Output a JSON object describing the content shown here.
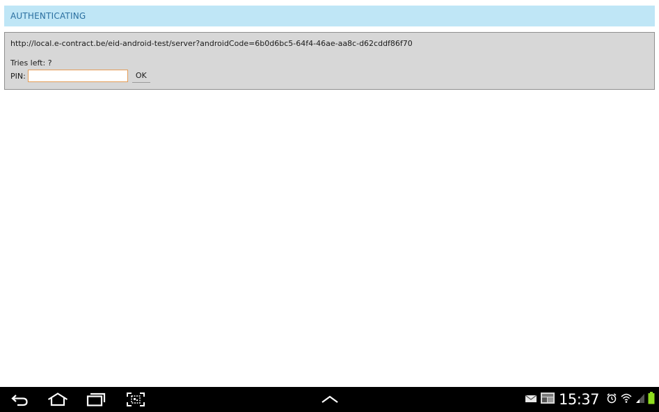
{
  "header": {
    "title": "AUTHENTICATING"
  },
  "panel": {
    "url": "http://local.e-contract.be/eid-android-test/server?androidCode=6b0d6bc5-64f4-46ae-aa8c-d62cddf86f70",
    "tries_left": "Tries left: ?",
    "pin_label": "PIN:",
    "pin_value": "",
    "ok_label": "OK"
  },
  "system_bar": {
    "time": "15:37",
    "icons": {
      "back": "back-icon",
      "home": "home-icon",
      "recents": "recent-apps-icon",
      "screenshot": "screenshot-icon",
      "up": "chevron-up-icon",
      "email": "email-icon",
      "gallery": "gallery-icon",
      "alarm": "alarm-icon",
      "wifi": "wifi-icon",
      "signal": "signal-icon",
      "battery": "battery-icon"
    },
    "colors": {
      "background": "#000000",
      "icon": "#ffffff",
      "battery": "#8fdc1e"
    }
  },
  "colors": {
    "header_bg": "#bfe6f6",
    "header_text": "#2a6fa0",
    "panel_bg": "#d7d7d7",
    "input_border": "#e39b55"
  }
}
